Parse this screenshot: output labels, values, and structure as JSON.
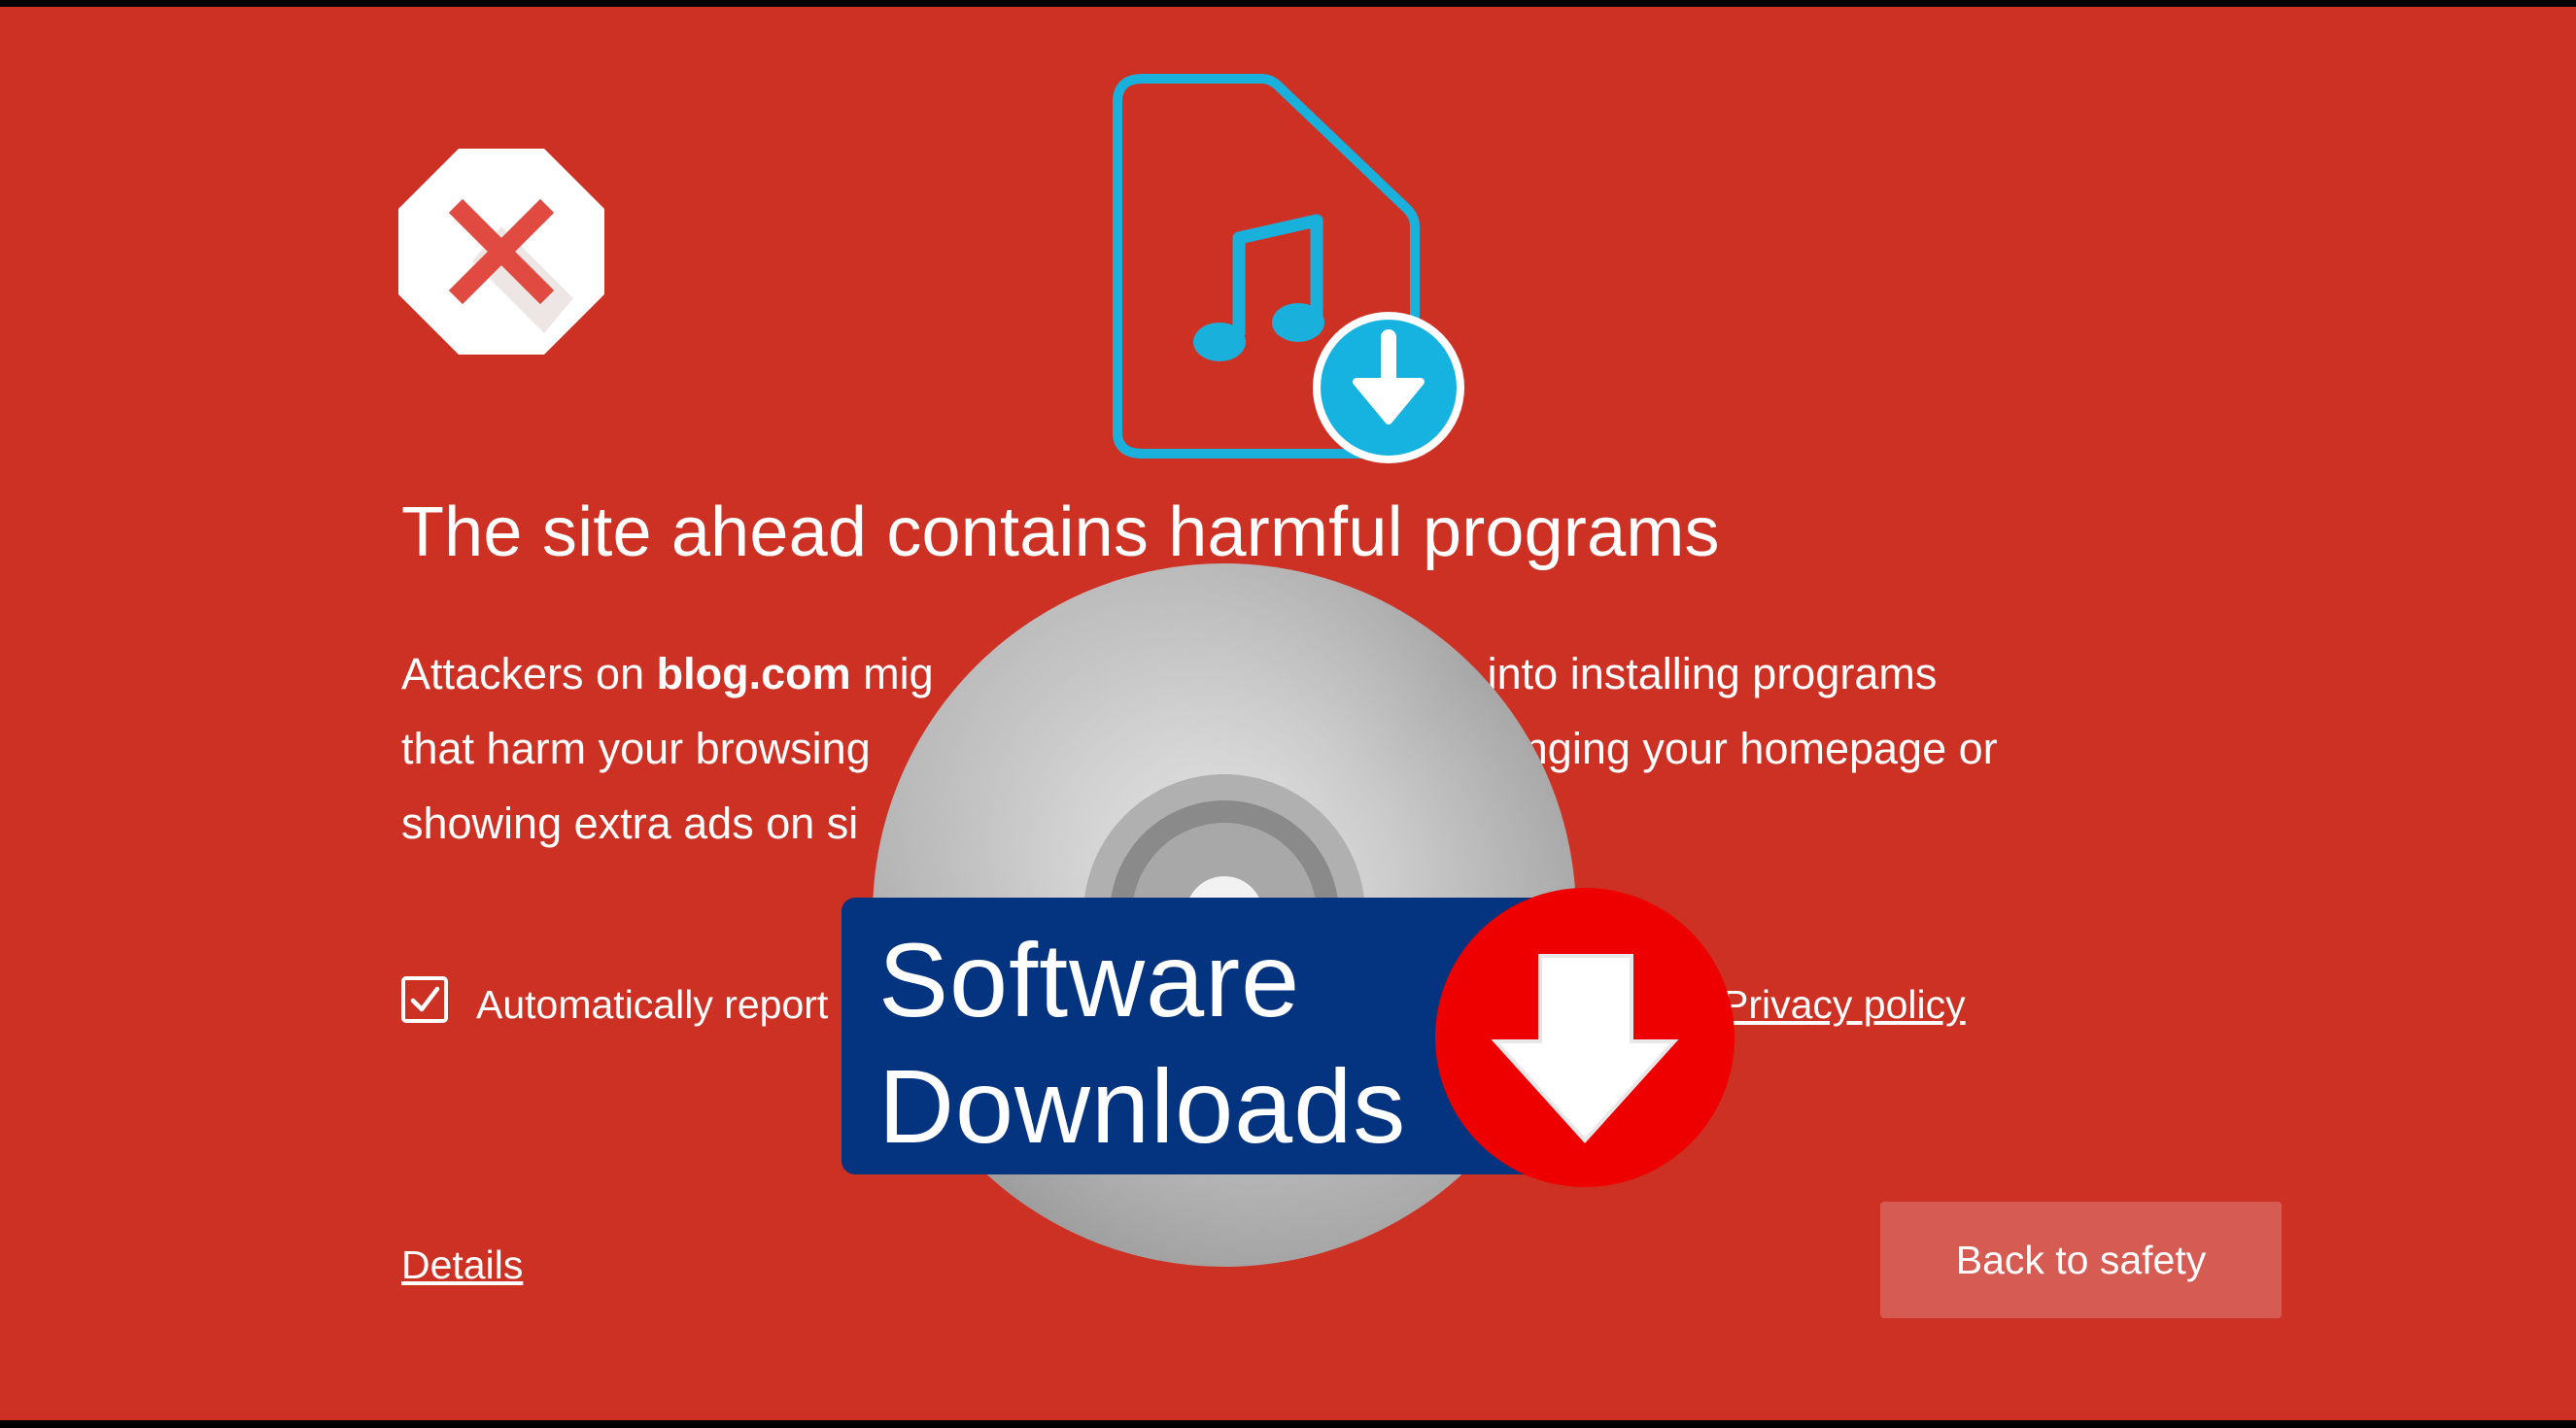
{
  "warning": {
    "title": "The site ahead contains harmful programs",
    "paragraph": {
      "line1_prefix": "Attackers on ",
      "domain": "blog.com",
      "line1_suffix": " mig",
      "line1_end": "into installing programs",
      "line2_start": "that harm your browsing",
      "line2_end": "hanging your homepage or",
      "line3_start": "showing extra ads on si"
    },
    "report_checkbox_checked": true,
    "report_label": "Automatically report",
    "privacy_link": "Privacy policy",
    "details_link": "Details",
    "back_button": "Back to safety"
  },
  "overlay": {
    "banner_line1": "Software",
    "banner_line2": "Downloads"
  },
  "colors": {
    "page_background": "#cd3124",
    "button_background": "#d65c53",
    "banner_background": "#043480",
    "file_icon_stroke": "#1ab0dc",
    "download_red": "#ee0000"
  },
  "icons": [
    "stop-x-icon",
    "music-file-download-icon",
    "cd-disc-icon",
    "download-arrow-icon",
    "checkbox-checked-icon"
  ]
}
